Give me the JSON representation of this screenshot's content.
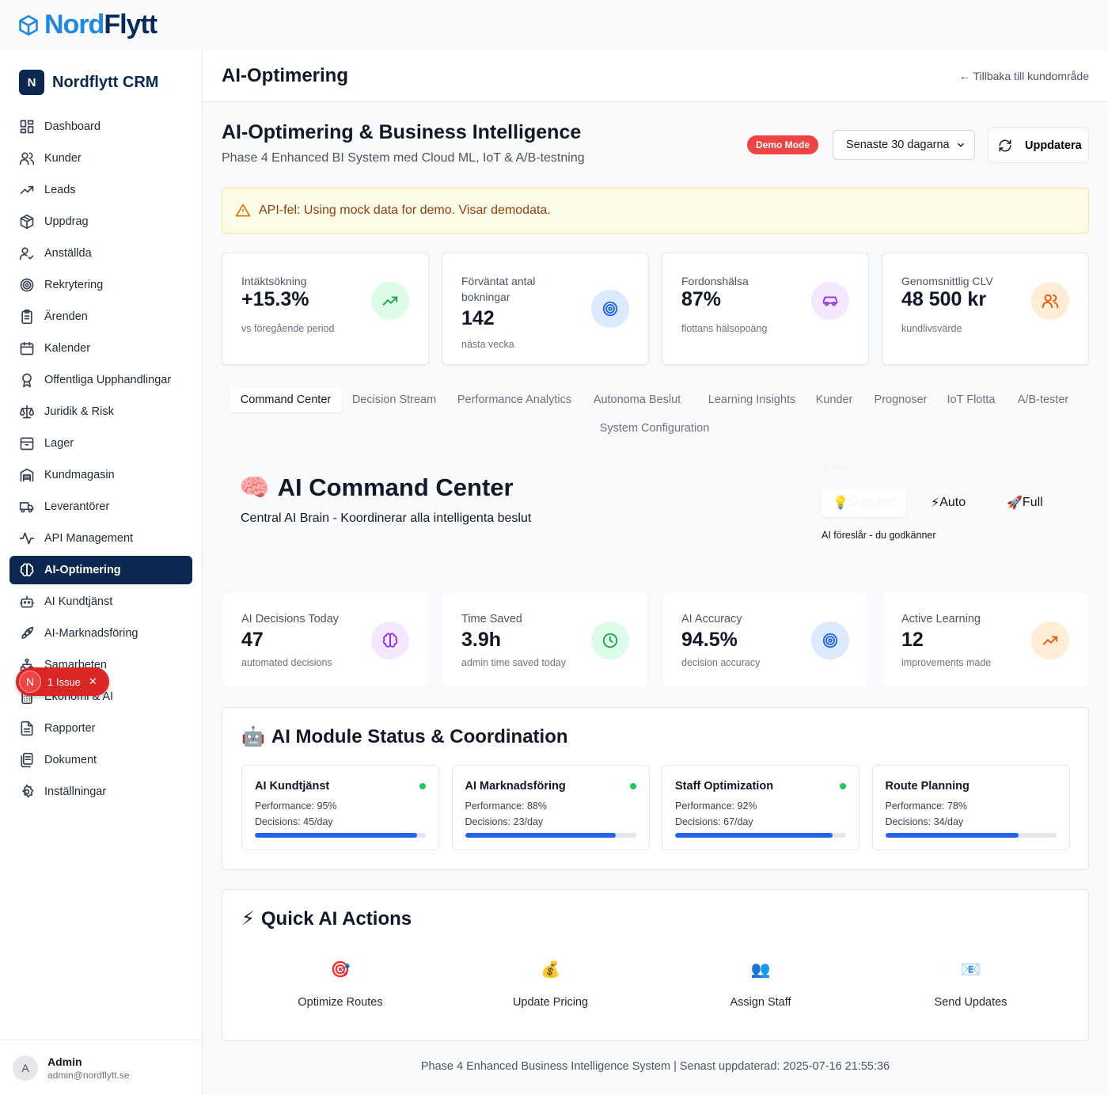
{
  "brand": {
    "part1": "Nord",
    "part2": "Flytt"
  },
  "sidebar": {
    "logo_letter": "N",
    "title": "Nordflytt CRM",
    "items": [
      {
        "label": "Dashboard"
      },
      {
        "label": "Kunder"
      },
      {
        "label": "Leads"
      },
      {
        "label": "Uppdrag"
      },
      {
        "label": "Anställda"
      },
      {
        "label": "Rekrytering"
      },
      {
        "label": "Ärenden"
      },
      {
        "label": "Kalender"
      },
      {
        "label": "Offentliga Upphandlingar"
      },
      {
        "label": "Juridik & Risk"
      },
      {
        "label": "Lager"
      },
      {
        "label": "Kundmagasin"
      },
      {
        "label": "Leverantörer"
      },
      {
        "label": "API Management"
      },
      {
        "label": "AI-Optimering",
        "active": true
      },
      {
        "label": "AI Kundtjänst"
      },
      {
        "label": "AI-Marknadsföring"
      },
      {
        "label": "Samarbeten"
      },
      {
        "label": "Ekonomi & AI"
      },
      {
        "label": "Rapporter"
      },
      {
        "label": "Dokument"
      },
      {
        "label": "Inställningar"
      }
    ],
    "user": {
      "initial": "A",
      "name": "Admin",
      "email": "admin@nordflytt.se"
    }
  },
  "issue_badge": {
    "letter": "N",
    "label": "1 Issue",
    "close": "✕"
  },
  "header": {
    "title": "AI-Optimering",
    "back_link": "← Tillbaka till kundområde"
  },
  "bi": {
    "title": "AI-Optimering & Business Intelligence",
    "subtitle": "Phase 4 Enhanced BI System med Cloud ML, IoT & A/B-testning",
    "demo_badge": "Demo Mode",
    "period": "Senaste 30 dagarna",
    "refresh": "Uppdatera"
  },
  "alert": {
    "text": "API-fel: Using mock data for demo. Visar demodata."
  },
  "kpis": [
    {
      "label": "Intäktsökning",
      "value": "+15.3%",
      "sub": "vs föregående period",
      "icon": "trending-up-icon",
      "color": "#16a34a",
      "bg": "#dcfce7"
    },
    {
      "label": "Förväntat antal bokningar",
      "value": "142",
      "sub": "nästa vecka",
      "icon": "target-icon",
      "color": "#2563eb",
      "bg": "#dbeafe"
    },
    {
      "label": "Fordonshälsa",
      "value": "87%",
      "sub": "flottans hälsopoäng",
      "icon": "car-icon",
      "color": "#9333ea",
      "bg": "#f3e8ff"
    },
    {
      "label": "Genomsnittlig CLV",
      "value": "48 500 kr",
      "sub": "kundlivsvärde",
      "icon": "users-icon",
      "color": "#ea580c",
      "bg": "#ffedd5"
    }
  ],
  "tabs": [
    {
      "label": "Command Center",
      "active": true
    },
    {
      "label": "Decision Stream"
    },
    {
      "label": "Performance Analytics"
    },
    {
      "label": "Autonoma Beslut"
    },
    {
      "label": "Learning Insights"
    },
    {
      "label": "Kunder"
    },
    {
      "label": "Prognoser"
    },
    {
      "label": "IoT Flotta"
    },
    {
      "label": "A/B-tester"
    },
    {
      "label": "System Configuration"
    }
  ],
  "command_center": {
    "emoji": "🧠",
    "title": "AI Command Center",
    "subtitle": "Central AI Brain - Koordinerar alla intelligenta beslut",
    "mode_label": "AI Mode",
    "modes": [
      {
        "emoji": "💡",
        "label": "Suggest",
        "selected": true
      },
      {
        "emoji": "⚡",
        "label": "Auto"
      },
      {
        "emoji": "🚀",
        "label": "Full"
      }
    ],
    "mode_desc": "AI föreslår - du godkänner"
  },
  "stats": [
    {
      "label": "AI Decisions Today",
      "value": "47",
      "sub": "automated decisions",
      "icon": "brain-icon",
      "color": "#9333ea",
      "bg": "#f3e8ff"
    },
    {
      "label": "Time Saved",
      "value": "3.9h",
      "sub": "admin time saved today",
      "icon": "clock-icon",
      "color": "#16a34a",
      "bg": "#dcfce7"
    },
    {
      "label": "AI Accuracy",
      "value": "94.5%",
      "sub": "decision accuracy",
      "icon": "target-icon",
      "color": "#2563eb",
      "bg": "#dbeafe"
    },
    {
      "label": "Active Learning",
      "value": "12",
      "sub": "improvements made",
      "icon": "trending-up-icon",
      "color": "#ea580c",
      "bg": "#ffedd5"
    }
  ],
  "modules": {
    "emoji": "🤖",
    "title": "AI Module Status & Coordination",
    "items": [
      {
        "name": "AI Kundtjänst",
        "performance": "Performance: 95%",
        "decisions": "Decisions: 45/day",
        "level": 0.95,
        "active": true
      },
      {
        "name": "AI Marknadsföring",
        "performance": "Performance: 88%",
        "decisions": "Decisions: 23/day",
        "level": 0.88,
        "active": true
      },
      {
        "name": "Staff Optimization",
        "performance": "Performance: 92%",
        "decisions": "Decisions: 67/day",
        "level": 0.92,
        "active": true
      },
      {
        "name": "Route Planning",
        "performance": "Performance: 78%",
        "decisions": "Decisions: 34/day",
        "level": 0.78,
        "active": false
      }
    ]
  },
  "quick_actions": {
    "emoji": "⚡",
    "title": "Quick AI Actions",
    "items": [
      {
        "emoji": "🎯",
        "label": "Optimize Routes"
      },
      {
        "emoji": "💰",
        "label": "Update Pricing"
      },
      {
        "emoji": "👥",
        "label": "Assign Staff"
      },
      {
        "emoji": "📧",
        "label": "Send Updates"
      }
    ]
  },
  "footer": {
    "text": "Phase 4 Enhanced Business Intelligence System | Senast uppdaterad: 2025-07-16 21:55:36"
  }
}
